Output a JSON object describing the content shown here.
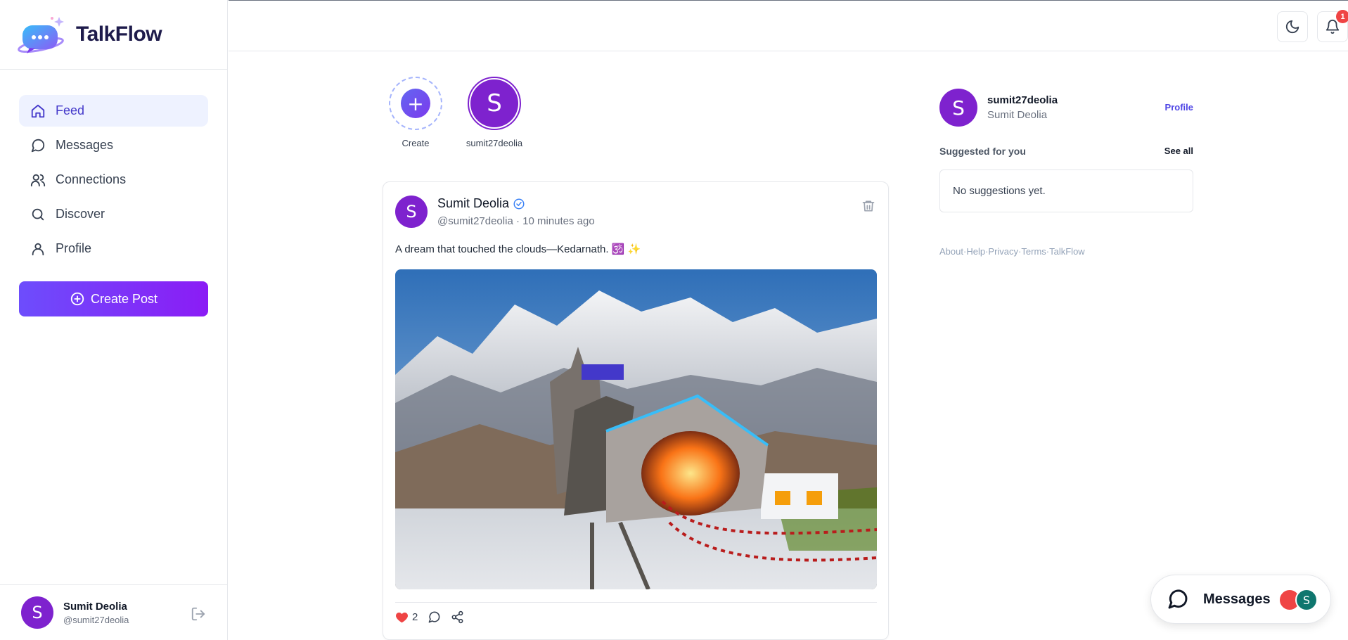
{
  "brand": {
    "name": "TalkFlow"
  },
  "nav": {
    "items": [
      {
        "label": "Feed",
        "icon": "home-icon",
        "active": true
      },
      {
        "label": "Messages",
        "icon": "message-circle-icon",
        "active": false
      },
      {
        "label": "Connections",
        "icon": "users-icon",
        "active": false
      },
      {
        "label": "Discover",
        "icon": "search-icon",
        "active": false
      },
      {
        "label": "Profile",
        "icon": "user-icon",
        "active": false
      }
    ],
    "create_post": "Create Post"
  },
  "current_user": {
    "initial": "S",
    "name": "Sumit Deolia",
    "handle": "@sumit27deolia",
    "username": "sumit27deolia"
  },
  "topbar": {
    "notification_count": "1"
  },
  "stories": {
    "create_label": "Create",
    "create_symbol": "+",
    "user_label": "sumit27deolia",
    "user_initial": "S"
  },
  "post": {
    "author": "Sumit Deolia",
    "initial": "S",
    "handle": "@sumit27deolia",
    "separator": "·",
    "time": "10 minutes ago",
    "text": "A dream that touched the clouds—Kedarnath. 🕉️ ✨",
    "likes": "2"
  },
  "right_panel": {
    "username": "sumit27deolia",
    "name": "Sumit Deolia",
    "initial": "S",
    "profile_link": "Profile",
    "suggested_title": "Suggested for you",
    "see_all": "See all",
    "empty_text": "No suggestions yet.",
    "footer_links": [
      "About",
      "Help",
      "Privacy",
      "Terms",
      "TalkFlow"
    ],
    "footer_sep": "·"
  },
  "messages_pill": {
    "label": "Messages",
    "avatar_b_initial": "S"
  },
  "colors": {
    "accent": "#4f46e5",
    "avatar": "#7e22ce",
    "badge": "#ef4444"
  }
}
